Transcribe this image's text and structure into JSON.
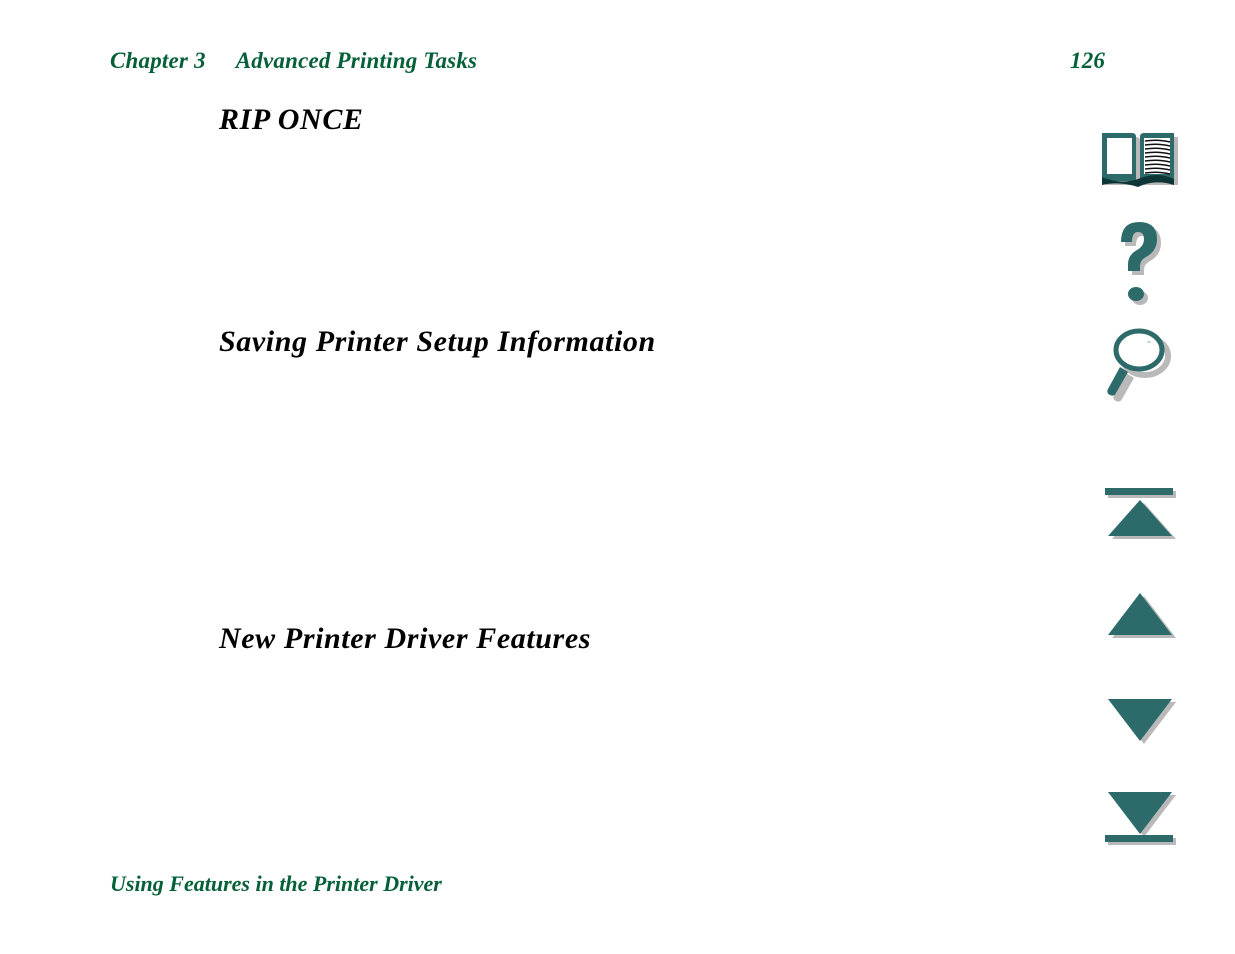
{
  "document": {
    "type": "pdf-manual-page",
    "background_color": "#ffffff"
  },
  "header": {
    "chapter_label": "Chapter 3",
    "chapter_title": "Advanced Printing Tasks",
    "page_number": "126",
    "color": "#056038"
  },
  "content": {
    "headings": [
      {
        "text": "RIP ONCE",
        "color": "#000000"
      },
      {
        "text": "Saving Printer Setup Information",
        "color": "#000000"
      },
      {
        "text": "New Printer Driver Features",
        "color": "#000000"
      }
    ]
  },
  "footer": {
    "link_text": "Using Features in the Printer Driver",
    "color": "#056038"
  },
  "nav_column": {
    "accent_color": "#2d6a6a",
    "shadow_color": "#b4b4b4",
    "items": [
      {
        "icon": "book-icon",
        "label": "Table of Contents"
      },
      {
        "icon": "question-mark-icon",
        "label": "Help"
      },
      {
        "icon": "magnifier-icon",
        "label": "Search"
      },
      {
        "icon": "first-page-icon",
        "label": "First Page"
      },
      {
        "icon": "previous-page-icon",
        "label": "Previous Page"
      },
      {
        "icon": "next-page-icon",
        "label": "Next Page"
      },
      {
        "icon": "last-page-icon",
        "label": "Last Page"
      }
    ]
  }
}
